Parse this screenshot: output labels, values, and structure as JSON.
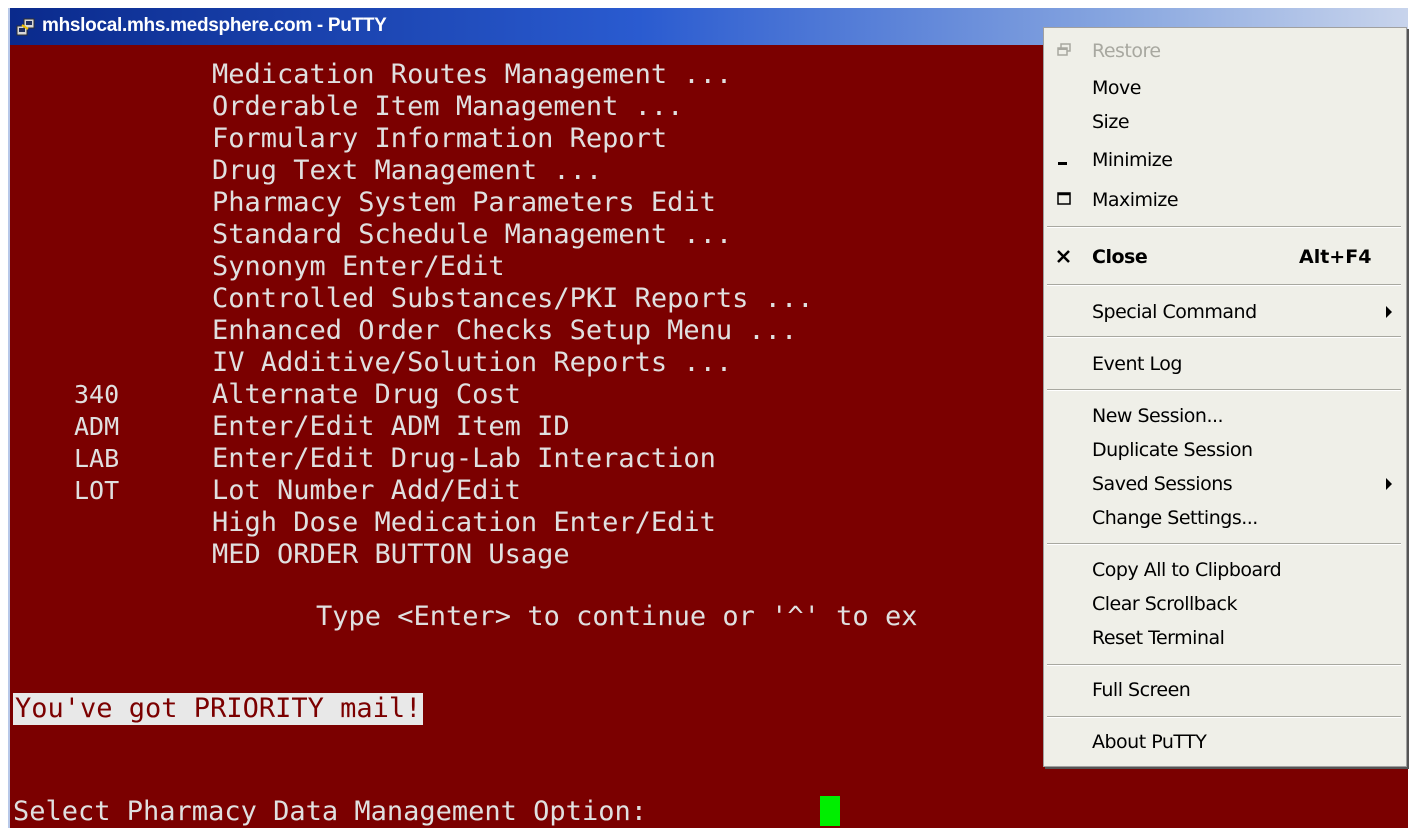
{
  "window": {
    "title": "mhslocal.mhs.medsphere.com - PuTTY"
  },
  "terminal": {
    "menu_lines": [
      {
        "code": "",
        "text": "Medication Routes Management ..."
      },
      {
        "code": "",
        "text": "Orderable Item Management ..."
      },
      {
        "code": "",
        "text": "Formulary Information Report"
      },
      {
        "code": "",
        "text": "Drug Text Management ..."
      },
      {
        "code": "",
        "text": "Pharmacy System Parameters Edit"
      },
      {
        "code": "",
        "text": "Standard Schedule Management ..."
      },
      {
        "code": "",
        "text": "Synonym Enter/Edit"
      },
      {
        "code": "",
        "text": "Controlled Substances/PKI Reports ..."
      },
      {
        "code": "",
        "text": "Enhanced Order Checks Setup Menu ..."
      },
      {
        "code": "",
        "text": "IV Additive/Solution Reports ..."
      },
      {
        "code": "340",
        "text": "Alternate Drug Cost"
      },
      {
        "code": "ADM",
        "text": "Enter/Edit ADM Item ID"
      },
      {
        "code": "LAB",
        "text": "Enter/Edit Drug-Lab Interaction"
      },
      {
        "code": "LOT",
        "text": "Lot Number Add/Edit"
      },
      {
        "code": "",
        "text": "High Dose Medication Enter/Edit"
      },
      {
        "code": "",
        "text": "MED ORDER BUTTON Usage"
      }
    ],
    "continue_prompt": "Type <Enter> to continue or '^' to ex",
    "mail_notice": "You've got PRIORITY mail!",
    "select_prompt": "Select Pharmacy Data Management Option: "
  },
  "context_menu": {
    "restore": "Restore",
    "move": "Move",
    "size": "Size",
    "minimize": "Minimize",
    "maximize": "Maximize",
    "close": "Close",
    "close_accel": "Alt+F4",
    "special_command": "Special Command",
    "event_log": "Event Log",
    "new_session": "New Session...",
    "duplicate_session": "Duplicate Session",
    "saved_sessions": "Saved Sessions",
    "change_settings": "Change Settings...",
    "copy_all": "Copy All to Clipboard",
    "clear_scrollback": "Clear Scrollback",
    "reset_terminal": "Reset Terminal",
    "full_screen": "Full Screen",
    "about": "About PuTTY"
  },
  "colors": {
    "terminal_bg": "#7b0000",
    "terminal_fg": "#e0e0e0",
    "cursor": "#00ee00",
    "menu_bg": "#efefe8"
  }
}
